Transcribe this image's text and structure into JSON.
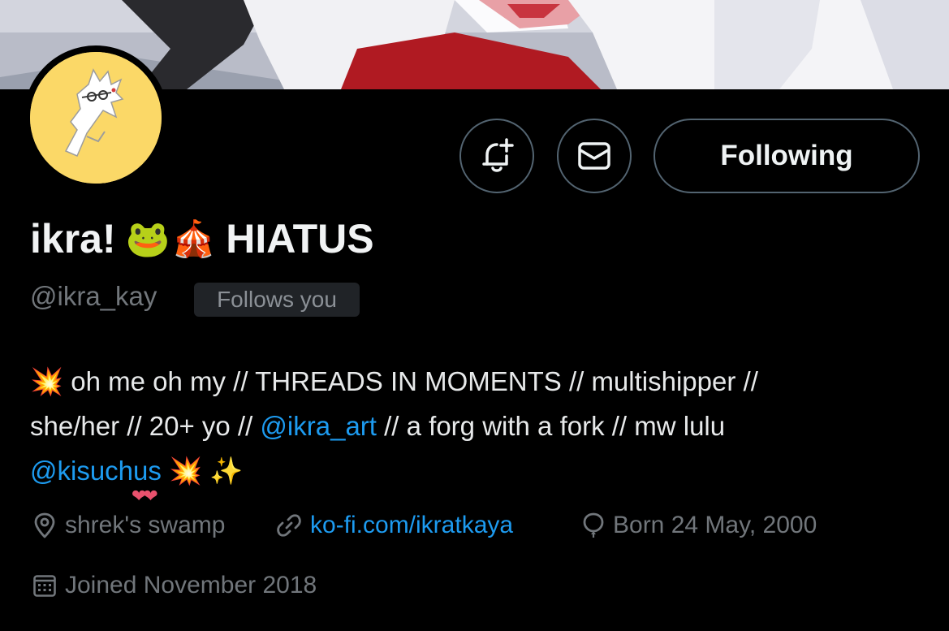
{
  "profile": {
    "display_name": "ikra!",
    "name_emojis": [
      "🐸",
      "🎪"
    ],
    "name_suffix": "HIATUS",
    "handle": "@ikra_kay",
    "follows_you_badge": "Follows you",
    "avatar_bg_color": "#fbd867"
  },
  "actions": {
    "notify_icon": "bell-plus-icon",
    "message_icon": "envelope-icon",
    "following_label": "Following"
  },
  "bio": {
    "line1": {
      "emoji": "💥",
      "text": "oh me oh my // THREADS IN MOMENTS // multishipper //"
    },
    "line2": {
      "text_before": "she/her // 20+ yo // ",
      "mention": "@ikra_art",
      "text_after": " // a forg with a fork // mw lulu"
    },
    "line3": {
      "mention": "@kisuchus",
      "emoji_a": "💥",
      "emoji_b": "✨"
    },
    "hearts": "❤❤"
  },
  "meta": {
    "location": "shrek's swamp",
    "website": "ko-fi.com/ikratkaya",
    "birthday": "Born 24 May, 2000",
    "joined": "Joined November 2018"
  },
  "colors": {
    "link": "#1d9bf0",
    "muted_text": "#71767b",
    "background": "#000000"
  }
}
